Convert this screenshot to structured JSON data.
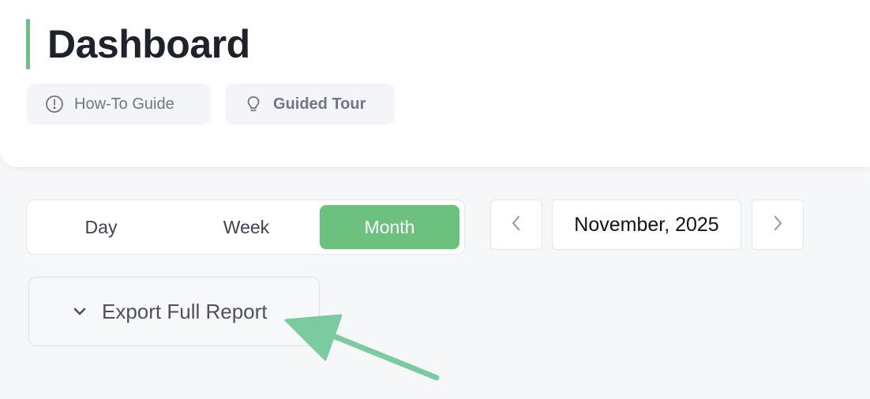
{
  "header": {
    "title": "Dashboard",
    "accent_color": "#6cc17e",
    "buttons": [
      {
        "label": "How-To Guide",
        "icon": "info-circle-icon"
      },
      {
        "label": "Guided Tour",
        "icon": "lightbulb-icon"
      }
    ]
  },
  "period_selector": {
    "options": [
      "Day",
      "Week",
      "Month"
    ],
    "selected": "Month"
  },
  "date_nav": {
    "current": "November, 2025",
    "prev_icon": "chevron-left-icon",
    "next_icon": "chevron-right-icon"
  },
  "export": {
    "label": "Export Full Report",
    "icon": "chevron-down-icon"
  },
  "annotation": {
    "arrow_color": "#7ccaa0"
  }
}
